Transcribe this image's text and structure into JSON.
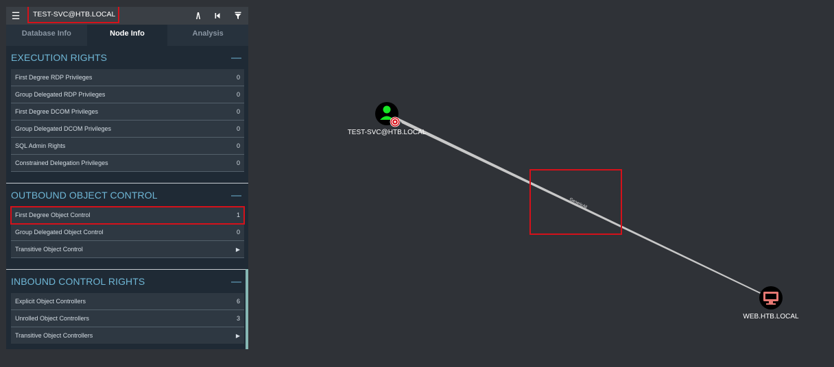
{
  "panel": {
    "search_value": "TEST-SVC@HTB.LOCAL",
    "tabs": [
      {
        "label": "Database Info",
        "active": false
      },
      {
        "label": "Node Info",
        "active": true
      },
      {
        "label": "Analysis",
        "active": false
      }
    ],
    "sections": [
      {
        "title": "EXECUTION RIGHTS",
        "collapse_symbol": "—",
        "rows": [
          {
            "label": "First Degree RDP Privileges",
            "value": "0"
          },
          {
            "label": "Group Delegated RDP Privileges",
            "value": "0"
          },
          {
            "label": "First Degree DCOM Privileges",
            "value": "0"
          },
          {
            "label": "Group Delegated DCOM Privileges",
            "value": "0"
          },
          {
            "label": "SQL Admin Rights",
            "value": "0"
          },
          {
            "label": "Constrained Delegation Privileges",
            "value": "0"
          }
        ]
      },
      {
        "title": "OUTBOUND OBJECT CONTROL",
        "collapse_symbol": "—",
        "rows": [
          {
            "label": "First Degree Object Control",
            "value": "1",
            "highlighted": true
          },
          {
            "label": "Group Delegated Object Control",
            "value": "0"
          },
          {
            "label": "Transitive Object Control",
            "value": "▶"
          }
        ]
      },
      {
        "title": "INBOUND CONTROL RIGHTS",
        "collapse_symbol": "—",
        "rows": [
          {
            "label": "Explicit Object Controllers",
            "value": "6"
          },
          {
            "label": "Unrolled Object Controllers",
            "value": "3"
          },
          {
            "label": "Transitive Object Controllers",
            "value": "▶"
          }
        ]
      }
    ]
  },
  "graph": {
    "nodes": [
      {
        "label": "TEST-SVC@HTB.LOCAL",
        "type": "user",
        "icon": "user-icon",
        "badge": "target-icon",
        "color": "#17e625"
      },
      {
        "label": "WEB.HTB.LOCAL",
        "type": "computer",
        "icon": "computer-icon",
        "color": "#e67873"
      }
    ],
    "edge": {
      "label": "GenericAll",
      "from": "TEST-SVC@HTB.LOCAL",
      "to": "WEB.HTB.LOCAL"
    }
  },
  "colors": {
    "background": "#2f3237",
    "panel": "#1f2a35",
    "accent": "#6fb7d6",
    "highlight": "#d6111a"
  },
  "icons": {
    "menu": "menu-icon",
    "pathfinding": "pathfinding-icon",
    "back": "back-icon",
    "filter": "filter-icon"
  }
}
